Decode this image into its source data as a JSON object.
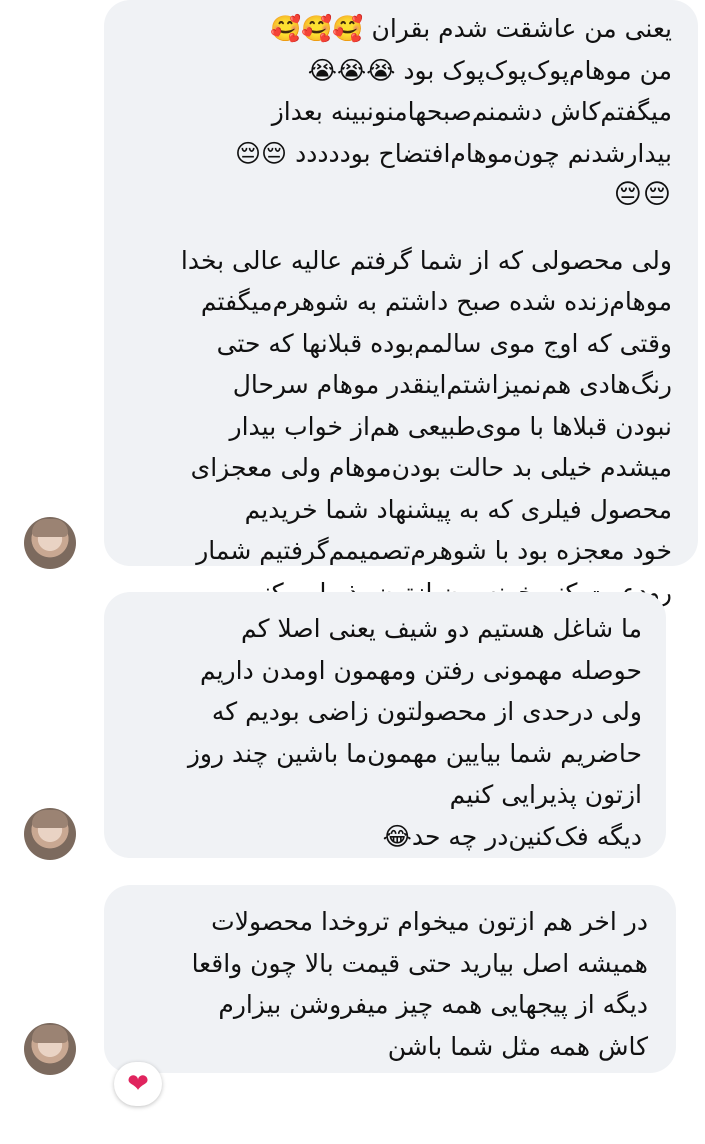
{
  "messages": [
    {
      "lines": [
        "یعنی من عاشقت شدم بقران 🥰🥰🥰",
        "من موهام‌پوک‌پوک‌پوک بود 😭😭😭",
        "میگفتم‌کاش دشمنم‌صبحهامنونبینه بعداز",
        "بیدارشدنم چون‌موهام‌افتضاح بوددددد 😔😔",
        "😔😔"
      ],
      "lines2": [
        "ولی محصولی که از شما گرفتم عالیه عالی بخدا",
        "موهام‌زنده شده صبح داشتم به شوهرم‌میگفتم",
        "وقتی که اوج موی سالمم‌بوده قبلانها که حتی",
        "رنگ‌هادی هم‌نمیزاشتم‌اینقدر موهام سرحال",
        "نبودن قبلاها با موی‌طبیعی هم‌از خواب بیدار",
        "میشدم خیلی بد حالت بودن‌موهام ولی معجزای",
        "محصول فیلری که به پیشنهاد شما خریدیم",
        "خود معجزه بود با شوهرم‌تصمیمم‌گرفتیم شمار",
        "رودعوت کنیم‌خونه‌مون ازتون پذیرایی کنیم"
      ]
    },
    {
      "lines": [
        "ما شاغل هستیم دو شیف یعنی اصلا کم",
        "حوصله مهمونی رفتن ومهمون اومدن داریم",
        "ولی درحدی از محصولتون زاضی بودیم که",
        "حاضریم شما بیایین مهمون‌ما باشین چند روز",
        "ازتون پذیرایی کنیم",
        "دیگه فک‌کنین‌در چه حد😂"
      ]
    },
    {
      "lines": [
        "در اخر هم ازتون میخوام تروخدا محصولات",
        "همیشه اصل بیارید حتی قیمت بالا چون واقعا",
        "دیگه از پیجهایی همه چیز میفروشن بیزارم",
        "کاش همه مثل شما باشن"
      ]
    }
  ],
  "reaction": {
    "symbol": "❤",
    "icon": "heart-icon",
    "color": "#e0245e"
  },
  "colors": {
    "bubble": "#f0f2f5",
    "text": "#111111",
    "background": "#ffffff"
  }
}
